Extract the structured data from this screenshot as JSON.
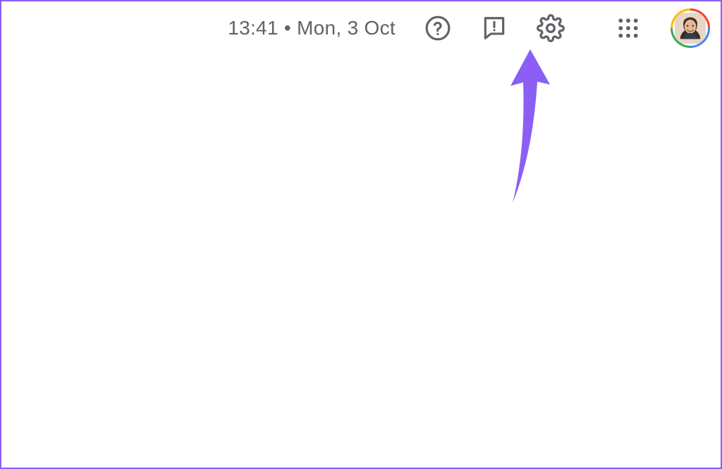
{
  "header": {
    "datetime": "13:41 • Mon, 3 Oct"
  },
  "icons": {
    "help": "help-circle-icon",
    "feedback": "feedback-icon",
    "settings": "gear-icon",
    "apps": "apps-grid-icon",
    "avatar": "profile-avatar"
  },
  "annotation": {
    "arrow_color": "#8b5ff5",
    "points_to": "settings-button"
  }
}
